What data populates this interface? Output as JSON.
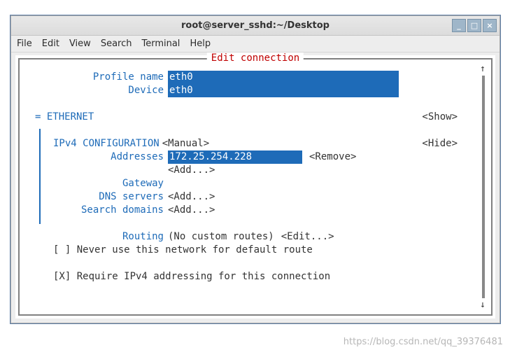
{
  "window": {
    "title": "root@server_sshd:~/Desktop"
  },
  "menu": {
    "file": "File",
    "edit": "Edit",
    "view": "View",
    "search": "Search",
    "terminal": "Terminal",
    "help": "Help"
  },
  "tui": {
    "title": "Edit connection",
    "profile_label": "Profile name",
    "profile_value": "eth0",
    "device_label": "Device",
    "device_value": "eth0",
    "ethernet_header": "= ETHERNET",
    "show": "<Show>",
    "ipv4_header": "IPv4 CONFIGURATION",
    "ipv4_mode": "<Manual>",
    "hide": "<Hide>",
    "addresses_label": "Addresses",
    "addresses_value": "172.25.254.228",
    "remove": "<Remove>",
    "add": "<Add...>",
    "gateway_label": "Gateway",
    "gateway_value": " ",
    "dns_label": "DNS servers",
    "search_label": "Search domains",
    "routing_label": "Routing",
    "routing_value": "(No custom routes)",
    "edit": "<Edit...>",
    "never_default": "[ ] Never use this network for default route",
    "require_ipv4": "[X] Require IPv4 addressing for this connection"
  },
  "watermark": "https://blog.csdn.net/qq_39376481"
}
